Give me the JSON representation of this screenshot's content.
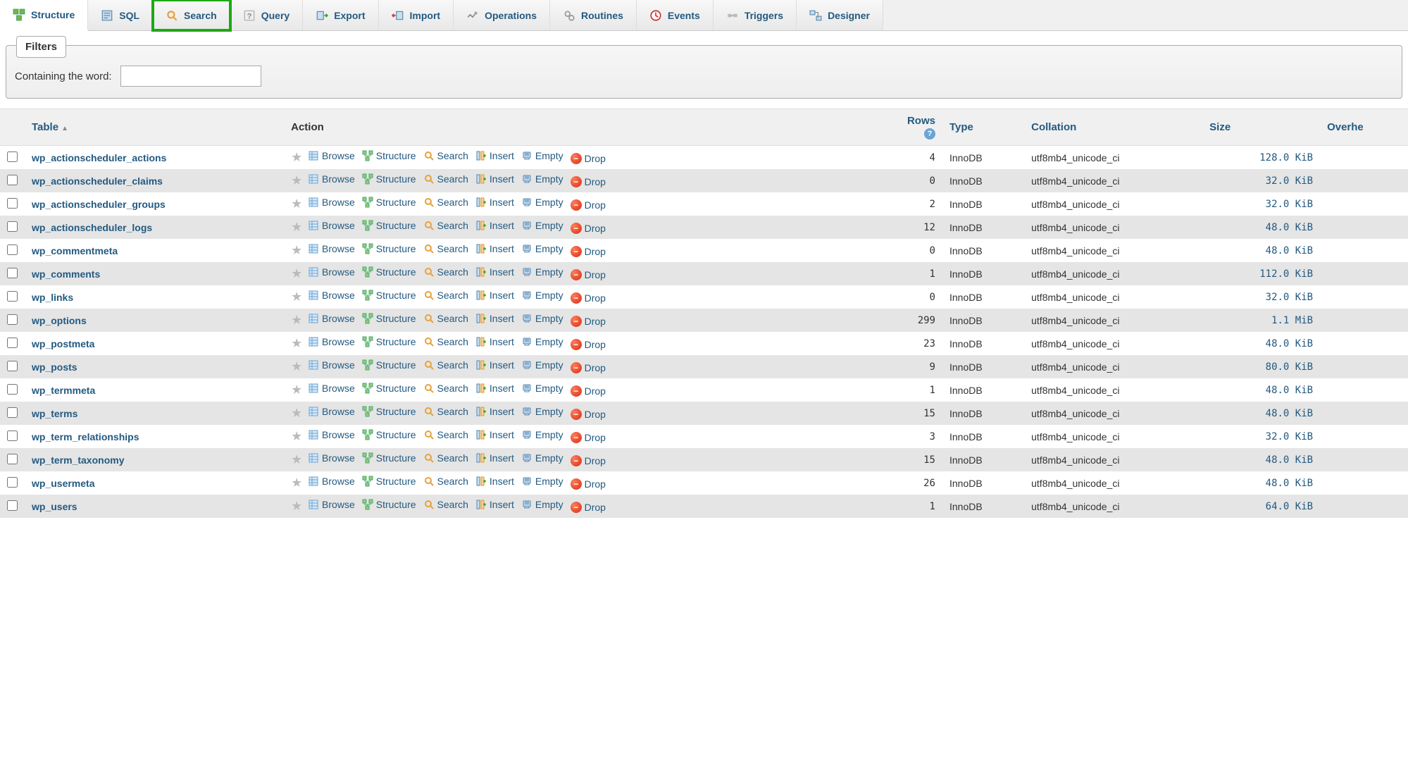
{
  "tabs": [
    {
      "label": "Structure",
      "icon": "structure"
    },
    {
      "label": "SQL",
      "icon": "sql"
    },
    {
      "label": "Search",
      "icon": "search"
    },
    {
      "label": "Query",
      "icon": "query"
    },
    {
      "label": "Export",
      "icon": "export"
    },
    {
      "label": "Import",
      "icon": "import"
    },
    {
      "label": "Operations",
      "icon": "operations"
    },
    {
      "label": "Routines",
      "icon": "routines"
    },
    {
      "label": "Events",
      "icon": "events"
    },
    {
      "label": "Triggers",
      "icon": "triggers"
    },
    {
      "label": "Designer",
      "icon": "designer"
    }
  ],
  "filters": {
    "legend": "Filters",
    "label": "Containing the word:",
    "value": ""
  },
  "columns": {
    "table": "Table",
    "action": "Action",
    "rows": "Rows",
    "type": "Type",
    "collation": "Collation",
    "size": "Size",
    "overhead": "Overhe"
  },
  "actions": {
    "browse": "Browse",
    "structure": "Structure",
    "search": "Search",
    "insert": "Insert",
    "empty": "Empty",
    "drop": "Drop"
  },
  "tables": [
    {
      "name": "wp_actionscheduler_actions",
      "rows": 4,
      "type": "InnoDB",
      "collation": "utf8mb4_unicode_ci",
      "size": "128.0 KiB"
    },
    {
      "name": "wp_actionscheduler_claims",
      "rows": 0,
      "type": "InnoDB",
      "collation": "utf8mb4_unicode_ci",
      "size": "32.0 KiB"
    },
    {
      "name": "wp_actionscheduler_groups",
      "rows": 2,
      "type": "InnoDB",
      "collation": "utf8mb4_unicode_ci",
      "size": "32.0 KiB"
    },
    {
      "name": "wp_actionscheduler_logs",
      "rows": 12,
      "type": "InnoDB",
      "collation": "utf8mb4_unicode_ci",
      "size": "48.0 KiB"
    },
    {
      "name": "wp_commentmeta",
      "rows": 0,
      "type": "InnoDB",
      "collation": "utf8mb4_unicode_ci",
      "size": "48.0 KiB"
    },
    {
      "name": "wp_comments",
      "rows": 1,
      "type": "InnoDB",
      "collation": "utf8mb4_unicode_ci",
      "size": "112.0 KiB"
    },
    {
      "name": "wp_links",
      "rows": 0,
      "type": "InnoDB",
      "collation": "utf8mb4_unicode_ci",
      "size": "32.0 KiB"
    },
    {
      "name": "wp_options",
      "rows": 299,
      "type": "InnoDB",
      "collation": "utf8mb4_unicode_ci",
      "size": "1.1 MiB"
    },
    {
      "name": "wp_postmeta",
      "rows": 23,
      "type": "InnoDB",
      "collation": "utf8mb4_unicode_ci",
      "size": "48.0 KiB"
    },
    {
      "name": "wp_posts",
      "rows": 9,
      "type": "InnoDB",
      "collation": "utf8mb4_unicode_ci",
      "size": "80.0 KiB"
    },
    {
      "name": "wp_termmeta",
      "rows": 1,
      "type": "InnoDB",
      "collation": "utf8mb4_unicode_ci",
      "size": "48.0 KiB"
    },
    {
      "name": "wp_terms",
      "rows": 15,
      "type": "InnoDB",
      "collation": "utf8mb4_unicode_ci",
      "size": "48.0 KiB"
    },
    {
      "name": "wp_term_relationships",
      "rows": 3,
      "type": "InnoDB",
      "collation": "utf8mb4_unicode_ci",
      "size": "32.0 KiB"
    },
    {
      "name": "wp_term_taxonomy",
      "rows": 15,
      "type": "InnoDB",
      "collation": "utf8mb4_unicode_ci",
      "size": "48.0 KiB"
    },
    {
      "name": "wp_usermeta",
      "rows": 26,
      "type": "InnoDB",
      "collation": "utf8mb4_unicode_ci",
      "size": "48.0 KiB"
    },
    {
      "name": "wp_users",
      "rows": 1,
      "type": "InnoDB",
      "collation": "utf8mb4_unicode_ci",
      "size": "64.0 KiB"
    }
  ]
}
